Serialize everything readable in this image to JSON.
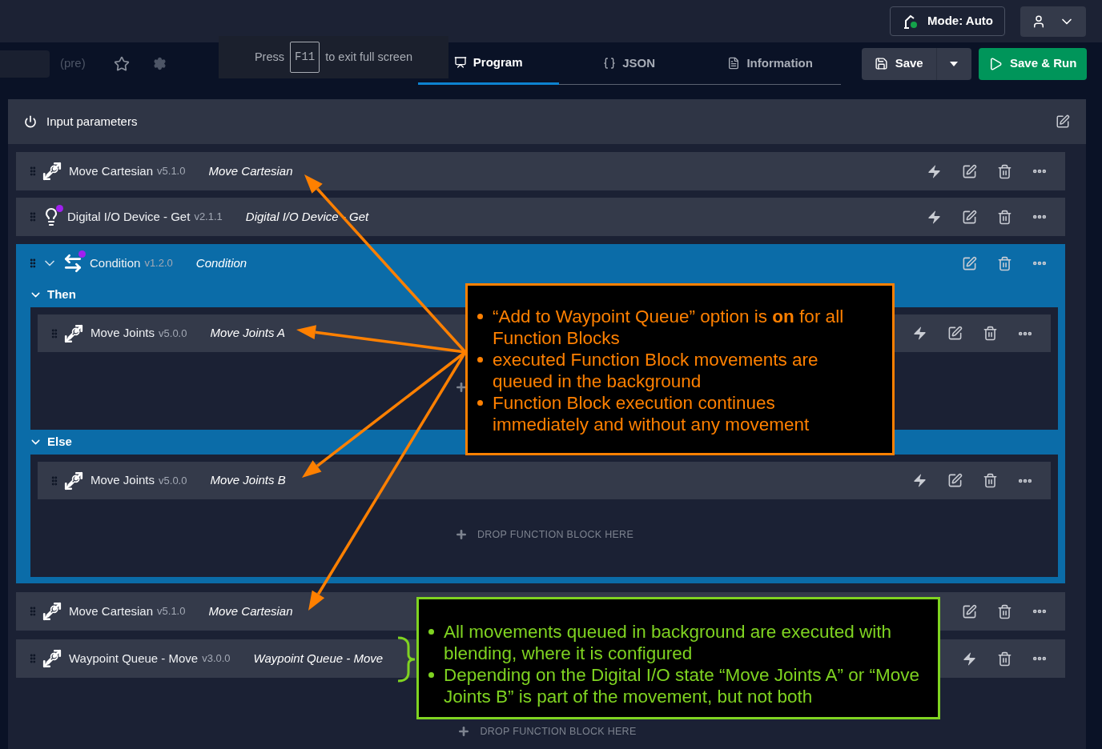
{
  "topbar": {
    "mode_button": "Mode: Auto"
  },
  "toolbar": {
    "title_suffix": "(pre)",
    "fullscreen_notice": {
      "before": "Press",
      "key": "F11",
      "after": "to exit full screen"
    },
    "save": "Save",
    "save_run": "Save & Run"
  },
  "tabs": [
    {
      "label": "Program",
      "kind": "program",
      "selected": true
    },
    {
      "label": "JSON",
      "kind": "json",
      "selected": false
    },
    {
      "label": "Information",
      "kind": "info",
      "selected": false
    }
  ],
  "input_parameters": {
    "label": "Input parameters"
  },
  "blocks": [
    {
      "kind": "move",
      "name": "Move Cartesian",
      "version": "v5.1.0",
      "label": "Move Cartesian",
      "marker": false,
      "actions": [
        {
          "kind": "run"
        },
        {
          "kind": "edit"
        },
        {
          "kind": "delete"
        },
        {
          "kind": "more"
        }
      ]
    },
    {
      "kind": "io",
      "name": "Digital I/O Device - Get",
      "version": "v2.1.1",
      "label": "Digital I/O Device - Get",
      "marker": true,
      "actions": [
        {
          "kind": "run"
        },
        {
          "kind": "edit"
        },
        {
          "kind": "delete"
        },
        {
          "kind": "more"
        }
      ]
    },
    {
      "kind": "condition",
      "name": "Condition",
      "version": "v1.2.0",
      "label": "Condition",
      "marker": true,
      "expanded": true,
      "actions": [
        {
          "kind": "edit"
        },
        {
          "kind": "delete"
        },
        {
          "kind": "more"
        }
      ],
      "branches": [
        {
          "label": "Then",
          "expanded": true,
          "blocks": [
            {
              "kind": "move",
              "name": "Move Joints",
              "version": "v5.0.0",
              "label": "Move Joints A",
              "marker": false,
              "actions": [
                {
                  "kind": "run"
                },
                {
                  "kind": "edit"
                },
                {
                  "kind": "delete"
                },
                {
                  "kind": "more"
                }
              ]
            }
          ]
        },
        {
          "label": "Else",
          "expanded": true,
          "drop_hint": "DROP FUNCTION BLOCK HERE",
          "blocks": [
            {
              "kind": "move",
              "name": "Move Joints",
              "version": "v5.0.0",
              "label": "Move Joints B",
              "marker": false,
              "actions": [
                {
                  "kind": "run"
                },
                {
                  "kind": "edit"
                },
                {
                  "kind": "delete"
                },
                {
                  "kind": "more"
                }
              ]
            }
          ]
        }
      ]
    },
    {
      "kind": "move",
      "name": "Move Cartesian",
      "version": "v5.1.0",
      "label": "Move Cartesian",
      "marker": false,
      "actions": [
        {
          "kind": "edit"
        },
        {
          "kind": "delete"
        },
        {
          "kind": "more"
        }
      ]
    },
    {
      "kind": "move",
      "name": "Waypoint Queue - Move",
      "version": "v3.0.0",
      "label": "Waypoint Queue - Move",
      "marker": false,
      "actions": [
        {
          "kind": "run"
        },
        {
          "kind": "delete"
        },
        {
          "kind": "more"
        }
      ]
    }
  ],
  "drop_hint": "DROP FUNCTION BLOCK HERE",
  "callouts": [
    {
      "kind": "orange",
      "bullets": [
        "“Add to Waypoint Queue” option is **on** for all Function Blocks",
        "executed Function Block movements are queued in the background",
        "Function Block execution continues immediately and without any movement"
      ]
    },
    {
      "kind": "green",
      "bullets": [
        "All movements queued in background are executed with blending, where it is configured",
        "Depending on the Digital I/O state “Move Joints A” or “Move Joints B” is part of the movement, but not both"
      ]
    }
  ]
}
